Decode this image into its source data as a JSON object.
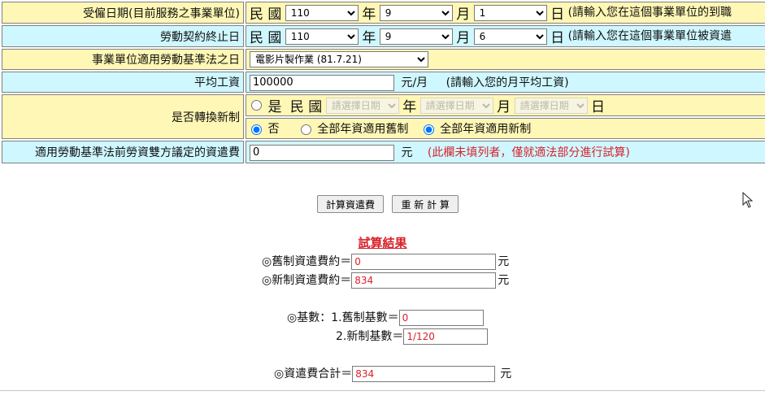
{
  "form": {
    "hire_date": {
      "label": "受僱日期(目前服務之事業單位)",
      "era": "民 國",
      "year": "110",
      "year_unit": "年",
      "month": "9",
      "month_unit": "月",
      "day": "1",
      "day_unit": "日",
      "hint": "(請輸入您在這個事業單位的到職"
    },
    "end_date": {
      "label": "勞動契約終止日",
      "era": "民 國",
      "year": "110",
      "year_unit": "年",
      "month": "9",
      "month_unit": "月",
      "day": "6",
      "day_unit": "日",
      "hint": "(請輸入您在這個事業單位被資遣"
    },
    "law_date": {
      "label": "事業單位適用勞動基準法之日",
      "selected": "電影片製作業 (81.7.21)"
    },
    "avg_wage": {
      "label": "平均工資",
      "value": "100000",
      "unit": "元/月",
      "hint": "(請輸入您的月平均工資)"
    },
    "switch": {
      "label": "是否轉換新制",
      "yes_label": "是",
      "era": "民 國",
      "placeholder": "請選擇日期",
      "year_unit": "年",
      "month_unit": "月",
      "day_unit": "日",
      "no_label": "否",
      "opt_old": "全部年資適用舊制",
      "opt_new": "全部年資適用新制"
    },
    "pre_law": {
      "label": "適用勞動基準法前勞資雙方議定的資遣費",
      "value": "0",
      "unit": "元",
      "hint": "(此欄未填列者，僅就適法部分進行試算)"
    }
  },
  "buttons": {
    "calculate": "計算資遣費",
    "reset": "重 新 計 算"
  },
  "result": {
    "title": "試算結果",
    "old_label": "◎舊制資遣費約＝",
    "old_value": "0",
    "new_label": "◎新制資遣費約＝",
    "new_value": "834",
    "unit": "元",
    "base_label": "◎基數：1.舊制基數＝",
    "base_old": "0",
    "base_new_label": "2.新制基數＝",
    "base_new": "1/120",
    "total_label": "◎資遣費合計＝",
    "total_value": "834"
  },
  "colors": {
    "label_bg": "#fff7b5",
    "field_bg": "#cff7ff",
    "accent_red": "#d8222a"
  }
}
